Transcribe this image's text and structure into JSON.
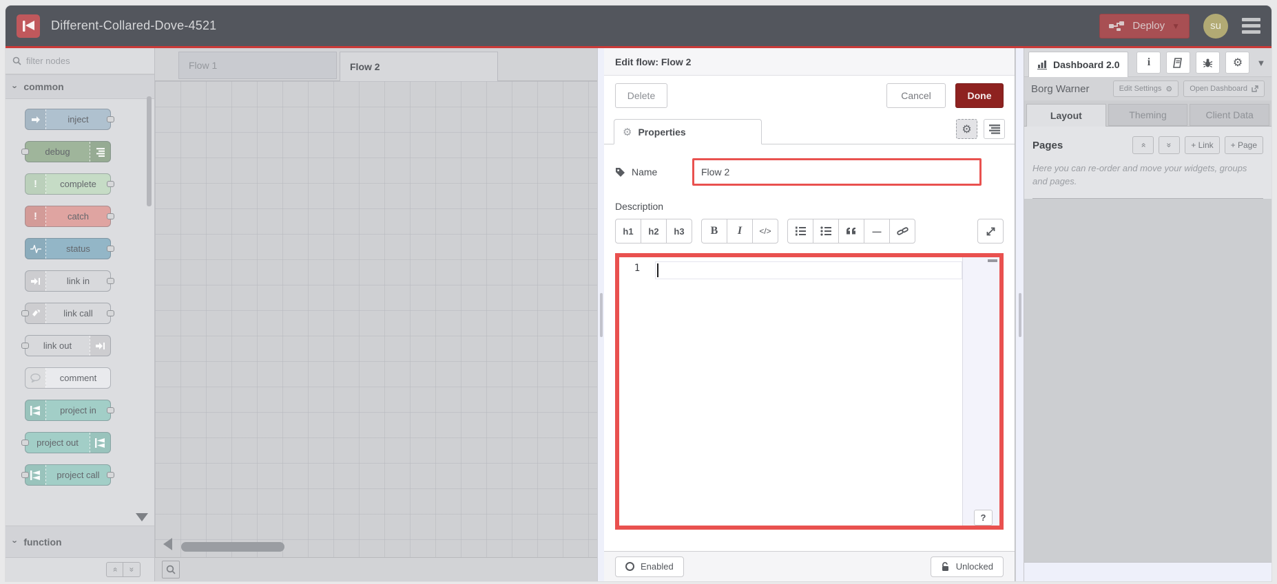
{
  "header": {
    "title": "Different-Collared-Dove-4521",
    "deploy_label": "Deploy",
    "avatar_initials": "su"
  },
  "palette": {
    "filter_placeholder": "filter nodes",
    "category_common": "common",
    "category_function": "function",
    "nodes": [
      {
        "label": "inject",
        "color": "#afc1cf"
      },
      {
        "label": "debug",
        "color": "#9fb59b"
      },
      {
        "label": "complete",
        "color": "#c6dcc6"
      },
      {
        "label": "catch",
        "color": "#dfa4a1"
      },
      {
        "label": "status",
        "color": "#93b6c7"
      },
      {
        "label": "link in",
        "color": "#d8d9dc"
      },
      {
        "label": "link call",
        "color": "#d8d9dc"
      },
      {
        "label": "link out",
        "color": "#d8d9dc"
      },
      {
        "label": "comment",
        "color": "#e9eaed"
      },
      {
        "label": "project in",
        "color": "#a2cec7"
      },
      {
        "label": "project out",
        "color": "#a2cec7"
      },
      {
        "label": "project call",
        "color": "#a2cec7"
      }
    ]
  },
  "workspace": {
    "tabs": [
      {
        "label": "Flow 1",
        "active": false
      },
      {
        "label": "Flow 2",
        "active": true
      }
    ]
  },
  "tray": {
    "title": "Edit flow: Flow 2",
    "delete_label": "Delete",
    "cancel_label": "Cancel",
    "done_label": "Done",
    "properties_tab": "Properties",
    "name_label": "Name",
    "name_value": "Flow 2",
    "description_label": "Description",
    "md": {
      "h1": "h1",
      "h2": "h2",
      "h3": "h3",
      "bold": "B",
      "italic": "I",
      "code": "</>",
      "hr": "—"
    },
    "editor": {
      "line_number": "1",
      "help_label": "?"
    },
    "enabled_label": "Enabled",
    "unlocked_label": "Unlocked"
  },
  "sidebar": {
    "tab_label": "Dashboard 2.0",
    "project_name": "Borg Warner",
    "edit_settings_label": "Edit Settings",
    "open_dashboard_label": "Open Dashboard",
    "tabs": [
      {
        "label": "Layout",
        "active": true
      },
      {
        "label": "Theming",
        "active": false
      },
      {
        "label": "Client Data",
        "active": false
      }
    ],
    "pages": {
      "title": "Pages",
      "link_button": "+ Link",
      "page_button": "+ Page",
      "hint": "Here you can re-order and move your widgets, groups and pages."
    }
  },
  "colors": {
    "annotation_red": "#e9514f",
    "header_red_line": "#cb3a38",
    "done_button": "#8e2220",
    "header_bg": "#53565d"
  }
}
